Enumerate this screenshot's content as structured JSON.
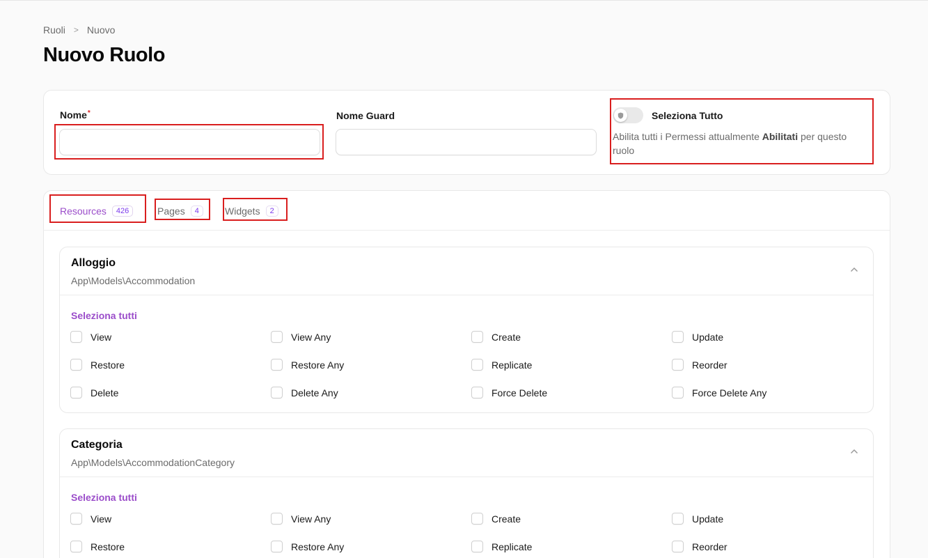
{
  "breadcrumb": {
    "parent": "Ruoli",
    "separator": ">",
    "current": "Nuovo"
  },
  "page_title": "Nuovo Ruolo",
  "form": {
    "name_label": "Nome",
    "name_required_mark": "*",
    "name_value": "",
    "guard_label": "Nome Guard",
    "guard_value": "",
    "select_all_label": "Seleziona Tutto",
    "select_all_helper_prefix": "Abilita tutti i Permessi attualmente",
    "select_all_helper_bold": "Abilitati",
    "select_all_helper_suffix": "per questo",
    "select_all_helper_line2": "ruolo",
    "select_all_toggle_on": false
  },
  "tabs": [
    {
      "label": "Resources",
      "count": "426",
      "active": true
    },
    {
      "label": "Pages",
      "count": "4",
      "active": false
    },
    {
      "label": "Widgets",
      "count": "2",
      "active": false
    }
  ],
  "sections": [
    {
      "title": "Alloggio",
      "model": "App\\Models\\Accommodation",
      "select_all": "Seleziona tutti",
      "permissions": [
        [
          "View",
          "View Any",
          "Create",
          "Update"
        ],
        [
          "Restore",
          "Restore Any",
          "Replicate",
          "Reorder"
        ],
        [
          "Delete",
          "Delete Any",
          "Force Delete",
          "Force Delete Any"
        ]
      ]
    },
    {
      "title": "Categoria",
      "model": "App\\Models\\AccommodationCategory",
      "select_all": "Seleziona tutti",
      "permissions": [
        [
          "View",
          "View Any",
          "Create",
          "Update"
        ],
        [
          "Restore",
          "Restore Any",
          "Replicate",
          "Reorder"
        ]
      ]
    }
  ],
  "icons": {
    "toggle_knob": "shield-icon",
    "section_toggle": "chevron-up-icon",
    "breadcrumb_separator": "chevron-right-icon"
  },
  "colors": {
    "accent": "#9b4dca",
    "highlight": "#d91e1e",
    "required": "#dc2626"
  }
}
